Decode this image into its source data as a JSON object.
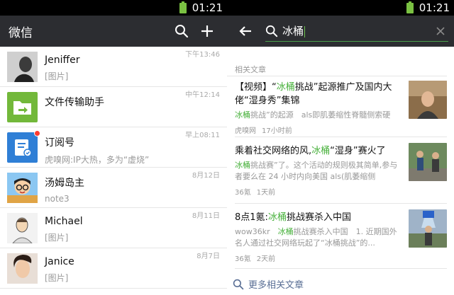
{
  "status": {
    "time_left": "01:21",
    "time_right": "01:21"
  },
  "left": {
    "title": "微信",
    "conversations": [
      {
        "name": "Jeniffer",
        "message": "[图片]",
        "time": "下午13:46"
      },
      {
        "name": "文件传输助手",
        "message": "",
        "time": "中午12:14"
      },
      {
        "name": "订阅号",
        "message": "虎嗅网:IP大热，多为“虚烧”",
        "time": "早上08:11"
      },
      {
        "name": "汤姆岛主",
        "message": "note3",
        "time": "8月12日"
      },
      {
        "name": "Michael",
        "message": "[图片]",
        "time": "8月11日"
      },
      {
        "name": "Janice",
        "message": "[图片]",
        "time": "8月7日"
      }
    ]
  },
  "right": {
    "search_value": "冰桶",
    "section_label": "相关文章",
    "articles": [
      {
        "title_pre": "【视频】“",
        "title_hl": "冰桶",
        "title_post": "挑战”起源推广及国内大佬“湿身秀”集锦",
        "snippet_hl": "冰桶",
        "snippet_post": "挑战”的起源　als即肌萎缩性脊髓侧索硬",
        "source": "虎嗅网",
        "time": "17小时前"
      },
      {
        "title_pre": "乘着社交网络的风,",
        "title_hl": "冰桶",
        "title_post": "“湿身”赛火了",
        "snippet_hl": "冰桶",
        "snippet_post": "挑战赛”了。这个活动的规则极其简单,参与者要么在 24 小时内向美国 als(肌萎缩侧",
        "source": "36氪",
        "time": "1天前"
      },
      {
        "title_pre": "8点1氪:",
        "title_hl": "冰桶",
        "title_post": "挑战赛杀入中国",
        "snippet_pre": "wow36kr　",
        "snippet_hl": "冰桶",
        "snippet_post": "挑战赛杀入中国　1. 近期国外名人通过社交网络玩起了“冰桶挑战”的...",
        "source": "36氪",
        "time": "2天前"
      }
    ],
    "more_label": "更多相关文章"
  },
  "colors": {
    "appbar": "#2c2d31",
    "accent_green": "#46b03a",
    "link_blue": "#5a6f95"
  }
}
